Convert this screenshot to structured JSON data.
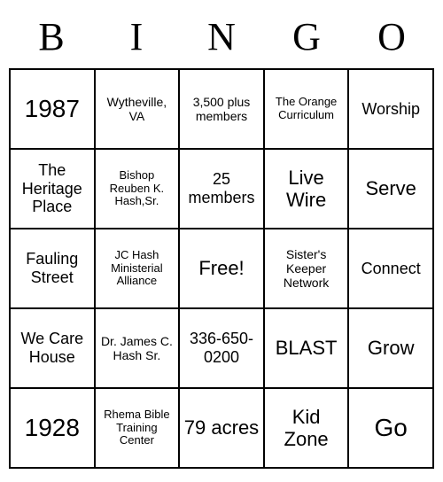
{
  "header": [
    "B",
    "I",
    "N",
    "G",
    "O"
  ],
  "cells": [
    {
      "text": "1987",
      "cls": "fs-xl"
    },
    {
      "text": "Wytheville, VA",
      "cls": "fs-sm"
    },
    {
      "text": "3,500 plus members",
      "cls": "fs-sm"
    },
    {
      "text": "The Orange Curriculum",
      "cls": "fs-xs"
    },
    {
      "text": "Worship",
      "cls": "fs-md"
    },
    {
      "text": "The Heritage Place",
      "cls": "fs-md"
    },
    {
      "text": "Bishop Reuben K. Hash,Sr.",
      "cls": "fs-xs"
    },
    {
      "text": "25 members",
      "cls": "fs-md"
    },
    {
      "text": "Live Wire",
      "cls": "fs-lg"
    },
    {
      "text": "Serve",
      "cls": "fs-lg"
    },
    {
      "text": "Fauling Street",
      "cls": "fs-md"
    },
    {
      "text": "JC Hash Ministerial Alliance",
      "cls": "fs-xs"
    },
    {
      "text": "Free!",
      "cls": "fs-lg"
    },
    {
      "text": "Sister's Keeper Network",
      "cls": "fs-sm"
    },
    {
      "text": "Connect",
      "cls": "fs-md"
    },
    {
      "text": "We Care House",
      "cls": "fs-md"
    },
    {
      "text": "Dr. James C. Hash Sr.",
      "cls": "fs-sm"
    },
    {
      "text": "336-650-0200",
      "cls": "fs-md"
    },
    {
      "text": "BLAST",
      "cls": "fs-lg"
    },
    {
      "text": "Grow",
      "cls": "fs-lg"
    },
    {
      "text": "1928",
      "cls": "fs-xl"
    },
    {
      "text": "Rhema Bible Training Center",
      "cls": "fs-xs"
    },
    {
      "text": "79 acres",
      "cls": "fs-lg"
    },
    {
      "text": "Kid Zone",
      "cls": "fs-lg"
    },
    {
      "text": "Go",
      "cls": "fs-xl"
    }
  ]
}
